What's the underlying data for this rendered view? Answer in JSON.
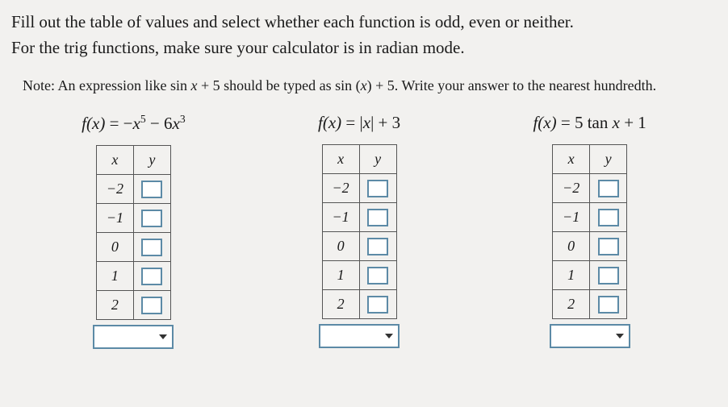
{
  "instruction_line1": "Fill out the table of values and select whether each function is odd, even or neither.",
  "instruction_line2": "For the trig functions, make sure your calculator is in radian mode.",
  "note_prefix": "Note: An expression like sin ",
  "note_mid1": " + 5 should be typed as sin (",
  "note_mid2": ") + 5. Write your answer to the nearest hundredth.",
  "note_var": "x",
  "headers": {
    "x": "x",
    "y": "y"
  },
  "xvals": [
    "−2",
    "−1",
    "0",
    "1",
    "2"
  ],
  "functions": {
    "f1": {
      "lhs": "f",
      "var": "x",
      "eq": " = ",
      "rhs_a": "−",
      "rhs_b": "x",
      "sup1": "5",
      "rhs_c": " − 6",
      "rhs_d": "x",
      "sup2": "3"
    },
    "f2": {
      "lhs": "f",
      "var": "x",
      "eq": " = |",
      "rhs_a": "x",
      "rhs_b": "| + 3"
    },
    "f3": {
      "lhs": "f",
      "var": "x",
      "eq": " = 5 tan ",
      "rhs_a": "x",
      "rhs_b": " + 1"
    }
  }
}
